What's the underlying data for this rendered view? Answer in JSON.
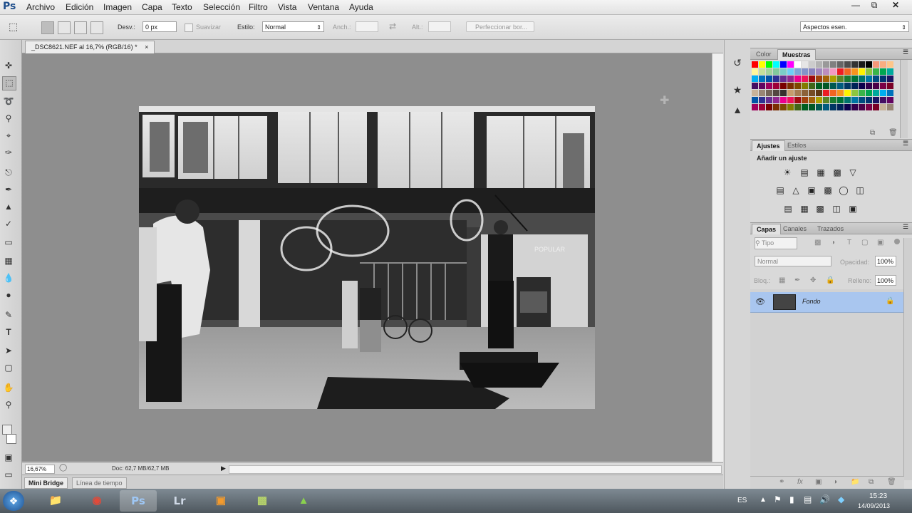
{
  "app": {
    "logo": "Ps"
  },
  "menu": [
    "Archivo",
    "Edición",
    "Imagen",
    "Capa",
    "Texto",
    "Selección",
    "Filtro",
    "Vista",
    "Ventana",
    "Ayuda"
  ],
  "options_bar": {
    "feather_label": "Desv.:",
    "feather_value": "0 px",
    "antialias_label": "Suavizar",
    "style_label": "Estilo:",
    "style_value": "Normal",
    "width_label": "Anch.:",
    "height_label": "Alt.:",
    "refine_edge_label": "Perfeccionar bor...",
    "workspace_value": "Aspectos esen."
  },
  "document": {
    "tab_title": "_DSC8621.NEF al 16,7% (RGB/16) *",
    "zoom": "16,67%",
    "doc_info": "Doc: 62,7 MB/62,7 MB"
  },
  "bottom_tabs": [
    "Mini Bridge",
    "Línea de tiempo"
  ],
  "color_panel": {
    "tabs": [
      "Color",
      "Muestras"
    ],
    "active": "Muestras"
  },
  "adjustments_panel": {
    "tabs": [
      "Ajustes",
      "Estilos"
    ],
    "active": "Ajustes",
    "heading": "Añadir un ajuste"
  },
  "layers_panel": {
    "tabs": [
      "Capas",
      "Canales",
      "Trazados"
    ],
    "active": "Capas",
    "filter_value": "Tipo",
    "blend_mode": "Normal",
    "opacity_label": "Opacidad:",
    "opacity_value": "100%",
    "lock_label": "Bloq.:",
    "fill_label": "Relleno:",
    "fill_value": "100%",
    "layers": [
      {
        "name": "Fondo",
        "visible": true,
        "locked": true
      }
    ]
  },
  "taskbar": {
    "apps": [
      "Explorer",
      "Chrome",
      "Ps",
      "Lr",
      "App",
      "App",
      "App"
    ],
    "lang": "ES",
    "time": "15:23",
    "date": "14/09/2013"
  },
  "photo_sign_text": "POPULAR",
  "colors": {
    "canvas_bg": "#8e8e8e",
    "selected_layer": "#a9c6ef",
    "ps_blue": "#1f4f8c"
  }
}
